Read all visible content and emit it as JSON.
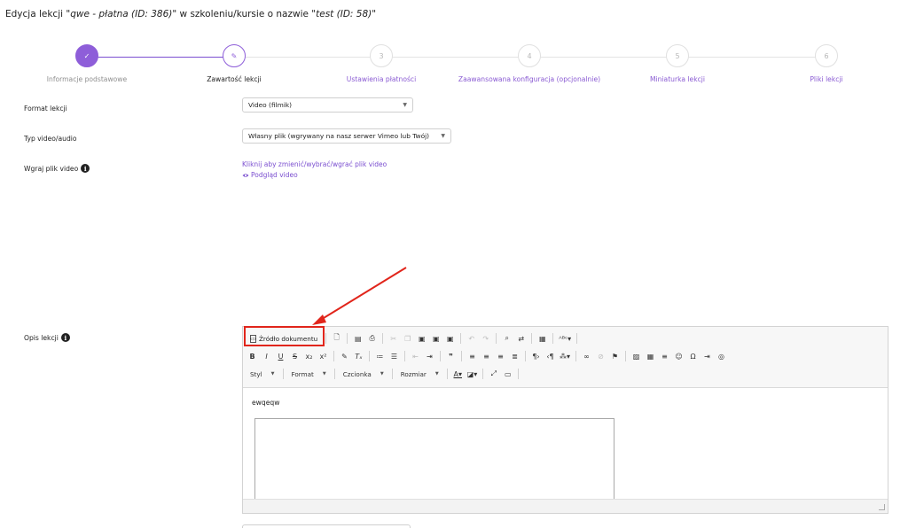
{
  "page": {
    "title_prefix": "Edycja lekcji \"",
    "lesson_name": "qwe - płatna (ID: 386)",
    "title_middle": "\" w szkoleniu/kursie o nazwie \"",
    "course_name": "test (ID: 58)",
    "title_suffix": "\""
  },
  "stepper": {
    "steps": [
      {
        "number": "✓",
        "label": "Informacje podstawowe",
        "state": "done"
      },
      {
        "number": "✎",
        "label": "Zawartość lekcji",
        "state": "active"
      },
      {
        "number": "3",
        "label": "Ustawienia płatności",
        "state": "todo"
      },
      {
        "number": "4",
        "label": "Zaawansowana konfiguracja (opcjonalnie)",
        "state": "todo"
      },
      {
        "number": "5",
        "label": "Miniaturka lekcji",
        "state": "todo"
      },
      {
        "number": "6",
        "label": "Pliki lekcji",
        "state": "todo"
      }
    ]
  },
  "form": {
    "format": {
      "label": "Format lekcji",
      "value": "Video (filmik)"
    },
    "type": {
      "label": "Typ video/audio",
      "value": "Własny plik (wgrywany na nasz serwer Vimeo lub Twój)"
    },
    "upload": {
      "label": "Wgraj plik video",
      "change_link": "Kliknij aby zmienić/wybrać/wgrać plik video",
      "preview_link": "Podgląd video"
    },
    "description": {
      "label": "Opis lekcji"
    }
  },
  "editor": {
    "source_button": "Źródło dokumentu",
    "style_label": "Styl",
    "format_label": "Format",
    "font_label": "Czcionka",
    "size_label": "Rozmiar",
    "content": "ewqeqw"
  },
  "colors": {
    "accent": "#8e5ed9",
    "annotation": "#e1251b"
  }
}
